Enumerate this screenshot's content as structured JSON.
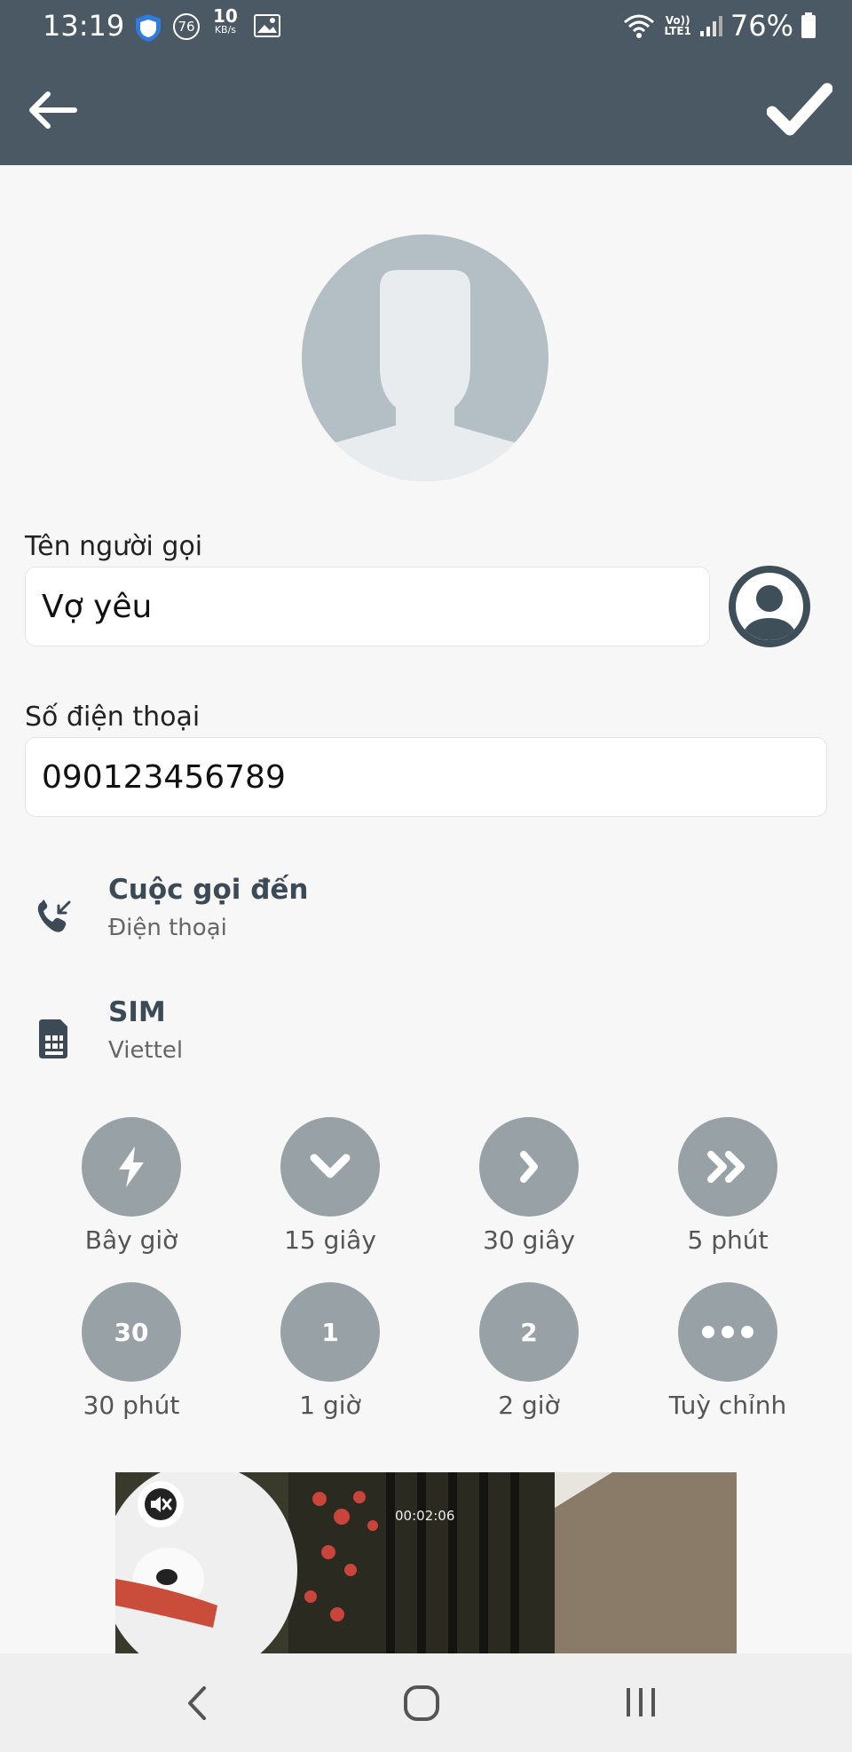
{
  "status_bar": {
    "time": "13:19",
    "notif_badge": "76",
    "speed_value": "10",
    "speed_unit": "KB/s",
    "network_label_top": "Vo))",
    "network_label_bottom": "LTE1",
    "battery": "76%"
  },
  "toolbar": {
    "back_icon": "arrow-left-icon",
    "confirm_icon": "check-icon"
  },
  "form": {
    "caller_name_label": "Tên người gọi",
    "caller_name_value": "Vợ yêu",
    "phone_label": "Số điện thoại",
    "phone_value": "090123456789"
  },
  "options": [
    {
      "title": "Cuộc gọi đến",
      "subtitle": "Điện thoại",
      "icon": "incoming-call-icon"
    },
    {
      "title": "SIM",
      "subtitle": "Viettel",
      "icon": "sim-card-icon"
    }
  ],
  "timers": [
    {
      "label": "Bây giờ",
      "icon": "lightning-icon"
    },
    {
      "label": "15 giây",
      "icon": "chevron-down-icon"
    },
    {
      "label": "30 giây",
      "icon": "chevron-right-icon"
    },
    {
      "label": "5 phút",
      "icon": "double-chevron-right-icon"
    },
    {
      "label": "30 phút",
      "badge": "30"
    },
    {
      "label": "1 giờ",
      "badge": "1"
    },
    {
      "label": "2 giờ",
      "badge": "2"
    },
    {
      "label": "Tuỳ chỉnh",
      "icon": "more-dots-icon"
    }
  ],
  "ad_video": {
    "timer": "00:02:06",
    "mute_icon": "muted-speaker-icon"
  },
  "colors": {
    "header": "#4a5964",
    "accent": "#3b4a55",
    "timer_circle": "#98a2a6",
    "background": "#f7f7f7"
  }
}
